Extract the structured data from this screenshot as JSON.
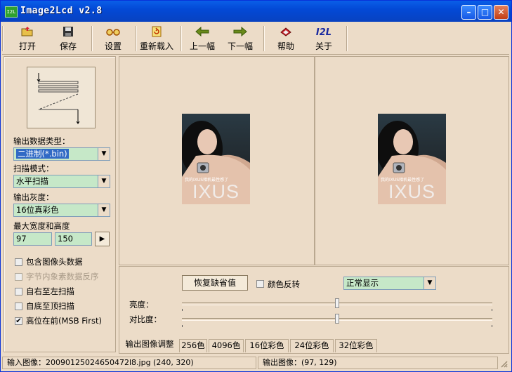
{
  "window": {
    "title": "Image2Lcd v2.8",
    "icon_text": "I2L"
  },
  "window_buttons": {
    "minimize": "–",
    "maximize": "□",
    "close": "✕"
  },
  "toolbar": {
    "open": "打开",
    "save": "保存",
    "settings": "设置",
    "reload": "重新载入",
    "prev": "上一幅",
    "next": "下一幅",
    "help": "帮助",
    "about": "关于",
    "about_icon_text": "I2L"
  },
  "left": {
    "output_type_label": "输出数据类型：",
    "output_type_value": "二进制(*.bin)",
    "scan_mode_label": "扫描模式：",
    "scan_mode_value": "水平扫描",
    "gray_label": "输出灰度：",
    "gray_value": "16位真彩色",
    "maxsize_label": "最大宽度和高度",
    "max_width": "97",
    "max_height": "150",
    "arrow_button": "▶",
    "options": [
      {
        "label": "包含图像头数据",
        "checked": false,
        "disabled": false
      },
      {
        "label": "字节内象素数据反序",
        "checked": false,
        "disabled": true
      },
      {
        "label": "自右至左扫描",
        "checked": false,
        "disabled": false
      },
      {
        "label": "自底至顶扫描",
        "checked": false,
        "disabled": false
      },
      {
        "label": "高位在前(MSB First)",
        "checked": true,
        "disabled": false
      }
    ]
  },
  "preview": {
    "photo_text": "IXUS",
    "photo_caption": "我的IXUS相机最性感了"
  },
  "adjust": {
    "restore_default": "恢复缺省值",
    "invert_label": "颜色反转",
    "display_mode": "正常显示",
    "brightness_label": "亮度：",
    "contrast_label": "对比度：",
    "brightness_level": 0.5,
    "contrast_level": 0.5
  },
  "tabs": [
    "输出图像调整",
    "256色",
    "4096色",
    "16位彩色",
    "24位彩色",
    "32位彩色"
  ],
  "status": {
    "input": "输入图像：20090125024650472l8.jpg (240, 320)",
    "output": "输出图像：(97, 129)"
  }
}
